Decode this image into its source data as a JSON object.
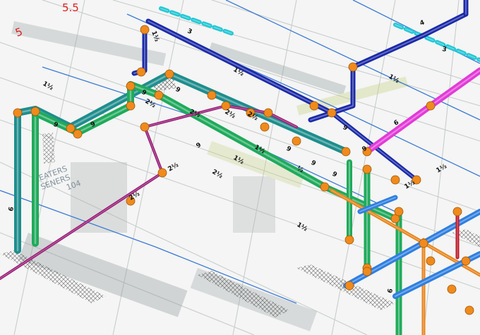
{
  "view": {
    "grid_labels": [
      "5.5",
      "5"
    ],
    "room_tag": [
      "EATERS",
      "SENERS",
      "104"
    ]
  },
  "pipe_labels": [
    "3",
    "1½",
    "4",
    "3",
    "9",
    "9",
    "9",
    "9",
    "2½",
    "2½",
    "2½",
    "2½",
    "2½",
    "9",
    "9",
    "9",
    "9",
    "½",
    "1½",
    "1½",
    "1½",
    "1½",
    "1½",
    "1½",
    "6",
    "9",
    "2½",
    "2½",
    "9",
    "1½",
    "1½",
    "6",
    "6"
  ],
  "colors": {
    "pipe_green": "#1faa5b",
    "pipe_teal": "#1e8d8d",
    "pipe_cyan": "#22c7d6",
    "pipe_navy": "#1b2aa8",
    "pipe_magenta": "#e23ad8",
    "pipe_purple": "#9a1e78",
    "pipe_orange": "#e8851d",
    "pipe_blue": "#2f7fe0",
    "pipe_red": "#c0182a",
    "fitting": "#f08a1c"
  }
}
